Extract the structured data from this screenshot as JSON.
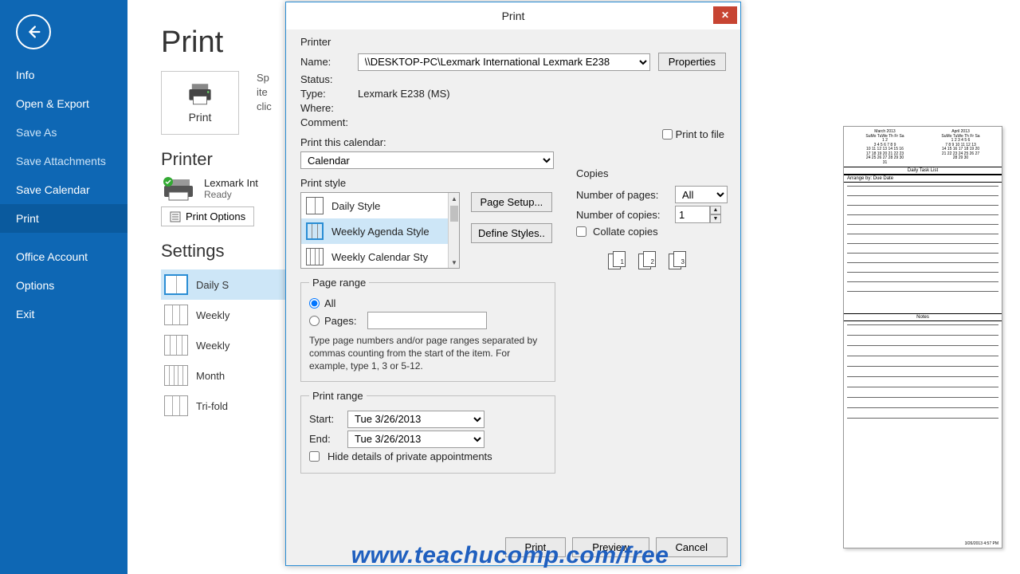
{
  "window_chrome": {
    "help": "?",
    "min": "—",
    "max": "❐",
    "close": "✕"
  },
  "sidebar": {
    "items": [
      {
        "label": "Info"
      },
      {
        "label": "Open & Export"
      },
      {
        "label": "Save As"
      },
      {
        "label": "Save Attachments"
      },
      {
        "label": "Save Calendar"
      },
      {
        "label": "Print"
      },
      {
        "label": "Office Account"
      },
      {
        "label": "Options"
      },
      {
        "label": "Exit"
      }
    ]
  },
  "backstage": {
    "title": "Print",
    "print_button": "Print",
    "desc_line1": "Sp",
    "desc_line2": "ite",
    "desc_line3": "clic",
    "printer_heading": "Printer",
    "printer_name": "Lexmark Int",
    "printer_status": "Ready",
    "print_options": "Print Options",
    "settings_heading": "Settings",
    "styles": [
      {
        "label": "Daily S"
      },
      {
        "label": "Weekly"
      },
      {
        "label": "Weekly"
      },
      {
        "label": "Month"
      },
      {
        "label": "Tri-fold"
      }
    ]
  },
  "modal": {
    "title": "Print",
    "printer_section": "Printer",
    "name_label": "Name:",
    "name_value": "\\\\DESKTOP-PC\\Lexmark International Lexmark E238",
    "properties": "Properties",
    "status_label": "Status:",
    "type_label": "Type:",
    "type_value": "Lexmark E238 (MS)",
    "where_label": "Where:",
    "comment_label": "Comment:",
    "print_to_file": "Print to file",
    "print_this_calendar": "Print this calendar:",
    "calendar_value": "Calendar",
    "print_style": "Print style",
    "style_options": [
      "Daily Style",
      "Weekly Agenda Style",
      "Weekly Calendar Sty"
    ],
    "page_setup": "Page Setup...",
    "define_styles": "Define Styles..",
    "copies_heading": "Copies",
    "num_pages_label": "Number of pages:",
    "num_pages_value": "All",
    "num_copies_label": "Number of copies:",
    "num_copies_value": "1",
    "collate": "Collate copies",
    "page_range_heading": "Page range",
    "all_label": "All",
    "pages_label": "Pages:",
    "hint": "Type page numbers and/or page ranges separated by commas counting from the start of the item.  For example, type 1, 3 or 5-12.",
    "print_range_heading": "Print range",
    "start_label": "Start:",
    "start_value": "Tue 3/26/2013",
    "end_label": "End:",
    "end_value": "Tue 3/26/2013",
    "hide_details": "Hide details of private appointments",
    "print_btn": "Print",
    "preview_btn": "Preview",
    "cancel_btn": "Cancel"
  },
  "preview": {
    "month1": "March 2013",
    "month2": "April 2013",
    "days": "SuMo TuWe Th Fr Sa",
    "task_list": "Daily Task List",
    "arrange": "Arrange by: Due Date",
    "notes": "Notes",
    "footer": "3/26/2013 4:57 PM"
  },
  "watermark": "www.teachucomp.com/free"
}
